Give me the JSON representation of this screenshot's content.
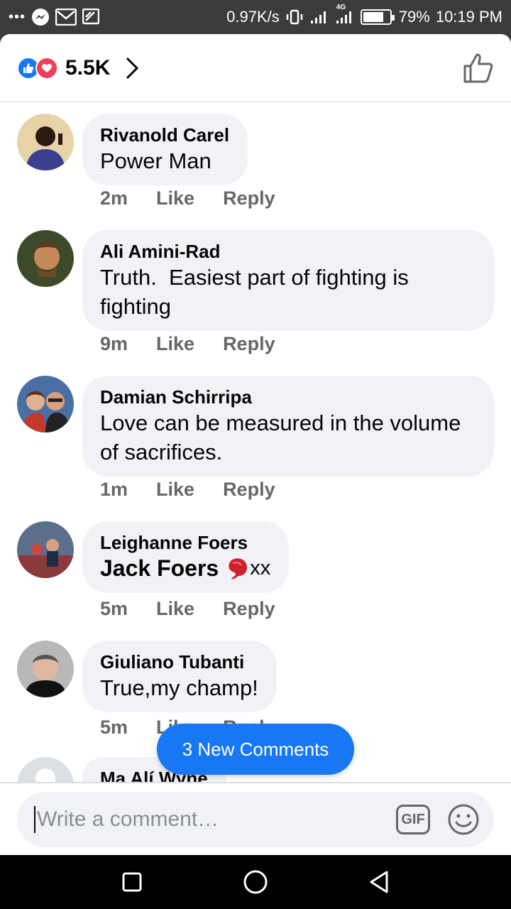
{
  "status": {
    "speed": "0.97K/s",
    "network": "4G",
    "battery": "79%",
    "battery_level": 0.79,
    "time": "10:19 PM",
    "dots": "•••"
  },
  "header": {
    "reaction_count": "5.5K"
  },
  "comments": [
    {
      "author": "Rivanold Carel",
      "text": "Power Man",
      "time": "2m",
      "like": "Like",
      "reply": "Reply"
    },
    {
      "author": "Ali Amini-Rad",
      "text_line1": "Truth.  Easiest part of fighting is",
      "text_line2": "fighting",
      "time": "9m",
      "like": "Like",
      "reply": "Reply"
    },
    {
      "author": "Damian Schirripa",
      "text_line1": "Love can be measured in the volume",
      "text_line2": "of sacrifices.",
      "time": "1m",
      "like": "Like",
      "reply": "Reply"
    },
    {
      "author": "Leighanne Foers",
      "text": "Jack Foers",
      "text_suffix": "xx",
      "time": "5m",
      "like": "Like",
      "reply": "Reply"
    },
    {
      "author": "Giuliano Tubanti",
      "text": "True,my champ!",
      "time": "5m",
      "like": "Like",
      "reply": "Reply"
    },
    {
      "author": "Ma Alí Wyne"
    }
  ],
  "new_comments": "3 New Comments",
  "composer": {
    "placeholder": "Write a comment…",
    "gif": "GIF"
  },
  "colors": {
    "accent": "#1877f2",
    "bubble": "#f0f2f5",
    "muted": "#65676b"
  }
}
